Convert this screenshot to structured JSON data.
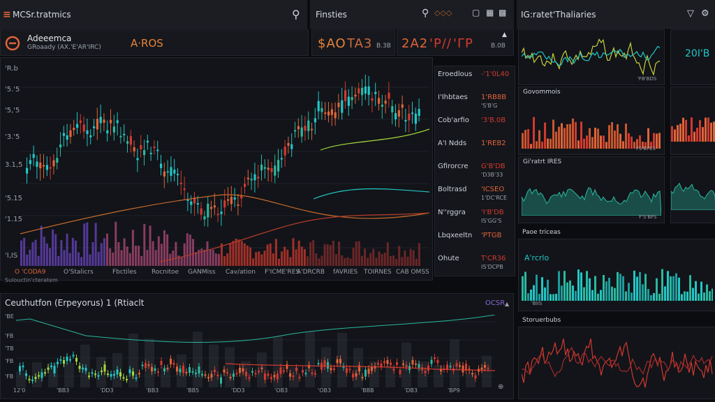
{
  "colors": {
    "bg": "#0b0c10",
    "panel": "#16181d",
    "orange": "#e0643a",
    "red": "#d2392f",
    "cyan": "#22c7c7",
    "teal": "#2bb8a0",
    "green": "#a5d83d",
    "purple": "#6b46c1",
    "yellow": "#c8cf3b"
  },
  "header": {
    "left_title": "MCSr.tratmics",
    "mid_title": "Finsties",
    "right_title": "IG:ratet'Thaliaries"
  },
  "account": {
    "name": "Adeeemca",
    "sub": "GRoaady (AX.'E'AR'IRC)",
    "value": "A·ROS"
  },
  "tickers": {
    "t1": "$AO",
    "t2": "TA3",
    "t2sub": "B.3B",
    "t3": "2A2",
    "t4": "'P//",
    "t5": "'ΓP",
    "t5sub": "B.0B"
  },
  "main_chart": {
    "y_ticks": [
      "'R.b",
      "'5.'5",
      "'5,'5",
      "'3.'5",
      "3.1,5",
      "'5.15",
      "'1.15",
      "'I,IS"
    ],
    "x_ticks": [
      "O'Stalicrs",
      "Fbctiles",
      "Rocnitoe",
      "GANMiss",
      "Cav/ation",
      "F'ICME'RES",
      "A'DRCRB",
      "fAVRIES",
      "TOIRNES",
      "CAB OMSS"
    ],
    "legend_value": "O 'CODA9",
    "footer_label": "Sulouctin'cteratem"
  },
  "watchlist": [
    {
      "name": "Eroedlous",
      "value": "-'1'0L40",
      "sub": ""
    },
    {
      "name": "I'Ihbtaes",
      "value": "1'RB8B",
      "sub": "'S'B'G"
    },
    {
      "name": "Cob'arfio",
      "value": "'3'B.0B",
      "sub": ""
    },
    {
      "name": "A'I Ndds",
      "value": "1'REB2",
      "sub": ""
    },
    {
      "name": "Gfirorcre",
      "value": "G'B'DB",
      "sub": "'D3B'33"
    },
    {
      "name": "Boltrasd",
      "value": "'ICSEO",
      "sub": "1'DC'RCE"
    },
    {
      "name": "N''rggra",
      "value": "'I'B'DB",
      "sub": "IS'GG'S"
    },
    {
      "name": "Lbqxeeltn",
      "value": "'PTGB",
      "sub": ""
    },
    {
      "name": "Ohute",
      "value": "T'CR36",
      "sub": "IS'DCPB"
    }
  ],
  "bottom_chart": {
    "title": "Ceuthutfon (Erpeyorus) 1 (Rtiaclt",
    "badge": "OCSR",
    "y_ticks": [
      "'BE",
      "'FB",
      "'TB",
      "'FB",
      "'FB"
    ],
    "x_ticks": [
      "12'0",
      "'BB3",
      "'DD3",
      "'BB3",
      "'BB5",
      "'DD3",
      "'OB3",
      "'OB3",
      "'BBB",
      "'DB3",
      "'BP9"
    ]
  },
  "mini_charts": [
    {
      "title": "",
      "tag": "'FB'BDS"
    },
    {
      "title": "Govommois",
      "tag": "FS'BI'ES"
    },
    {
      "title": "Gi'ratrt IRES",
      "tag": "F'S'BFS"
    },
    {
      "title": "Paoe triceas",
      "tag": ""
    },
    {
      "title": "A'rcrlo",
      "tag": "'BIIS"
    },
    {
      "title": "Storuerbubs",
      "tag": ""
    }
  ],
  "right_ticker": "20I'B"
}
